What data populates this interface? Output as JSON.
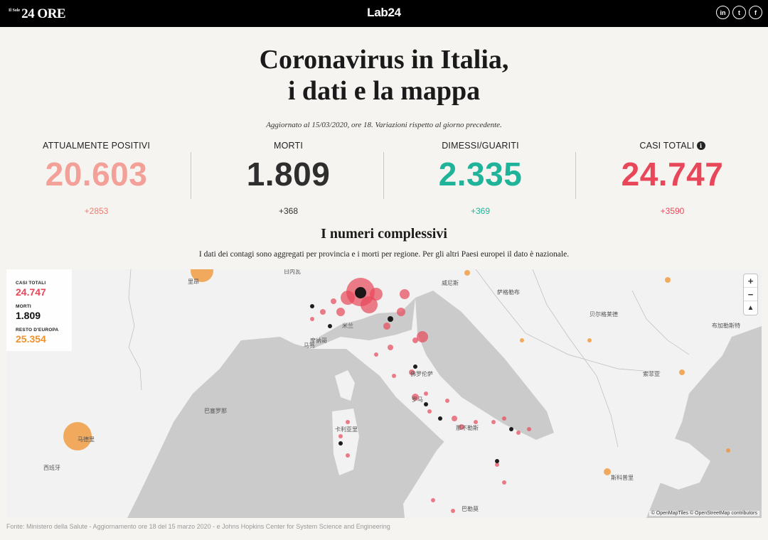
{
  "header": {
    "logo_small": "Il Sole",
    "logo_main": "24 ORE",
    "brand": "Lab24",
    "social": [
      {
        "icon": "linkedin-icon",
        "label": "in"
      },
      {
        "icon": "twitter-icon",
        "label": "t"
      },
      {
        "icon": "facebook-icon",
        "label": "f"
      }
    ]
  },
  "headline": {
    "line1": "Coronavirus in Italia,",
    "line2": "i dati e la mappa"
  },
  "updated": "Aggiornato al 15/03/2020, ore 18. Variazioni rispetto al giorno precedente.",
  "stats": [
    {
      "label": "ATTUALMENTE POSITIVI",
      "value": "20.603",
      "delta": "+2853",
      "color": "#f2a098",
      "delta_color": "#ea7d72"
    },
    {
      "label": "MORTI",
      "value": "1.809",
      "delta": "+368",
      "color": "#2e2e2e",
      "delta_color": "#333333"
    },
    {
      "label": "DIMESSI/GUARITI",
      "value": "2.335",
      "delta": "+369",
      "color": "#1fb49a",
      "delta_color": "#1fb49a"
    },
    {
      "label": "CASI TOTALI",
      "value": "24.747",
      "delta": "+3590",
      "color": "#e8475a",
      "delta_color": "#e8475a",
      "info_icon": "info-icon"
    }
  ],
  "section": {
    "title": "I numeri complessivi",
    "description": "I dati dei contagi sono aggregati per provincia e i morti per regione. Per gli altri Paesi europei il dato è nazionale."
  },
  "map": {
    "legend": {
      "total_label": "CASI TOTALI",
      "total_value": "24.747",
      "deaths_label": "MORTI",
      "deaths_value": "1.809",
      "europe_label": "RESTO D'EUROPA",
      "europe_value": "25.354"
    },
    "zoom": {
      "in": "+",
      "out": "−",
      "reset": "▲"
    },
    "attribution": "© OpenMapTiles © OpenStreetMap contributors",
    "place_labels": [
      "日内瓦",
      "米兰",
      "威尼斯",
      "马赛",
      "摩纳哥",
      "巴塞罗那",
      "马德里",
      "西班牙",
      "卡利亚里",
      "罗马",
      "那不勒斯",
      "萨格勒布",
      "贝尔格莱德",
      "布加勒斯特",
      "索菲亚",
      "斯科普里",
      "佛罗伦萨",
      "巴勒莫",
      "里昂"
    ],
    "colors": {
      "cases": "#e8475a",
      "deaths": "#111111",
      "europe": "#f0922b",
      "land": "#f2f2f2",
      "sea": "#cbcbcb"
    }
  },
  "source": "Fonte: Ministero della Salute - Aggiornamento ore 18 del 15 marzo 2020 - e Johns Hopkins Center for System Science and Engineering"
}
